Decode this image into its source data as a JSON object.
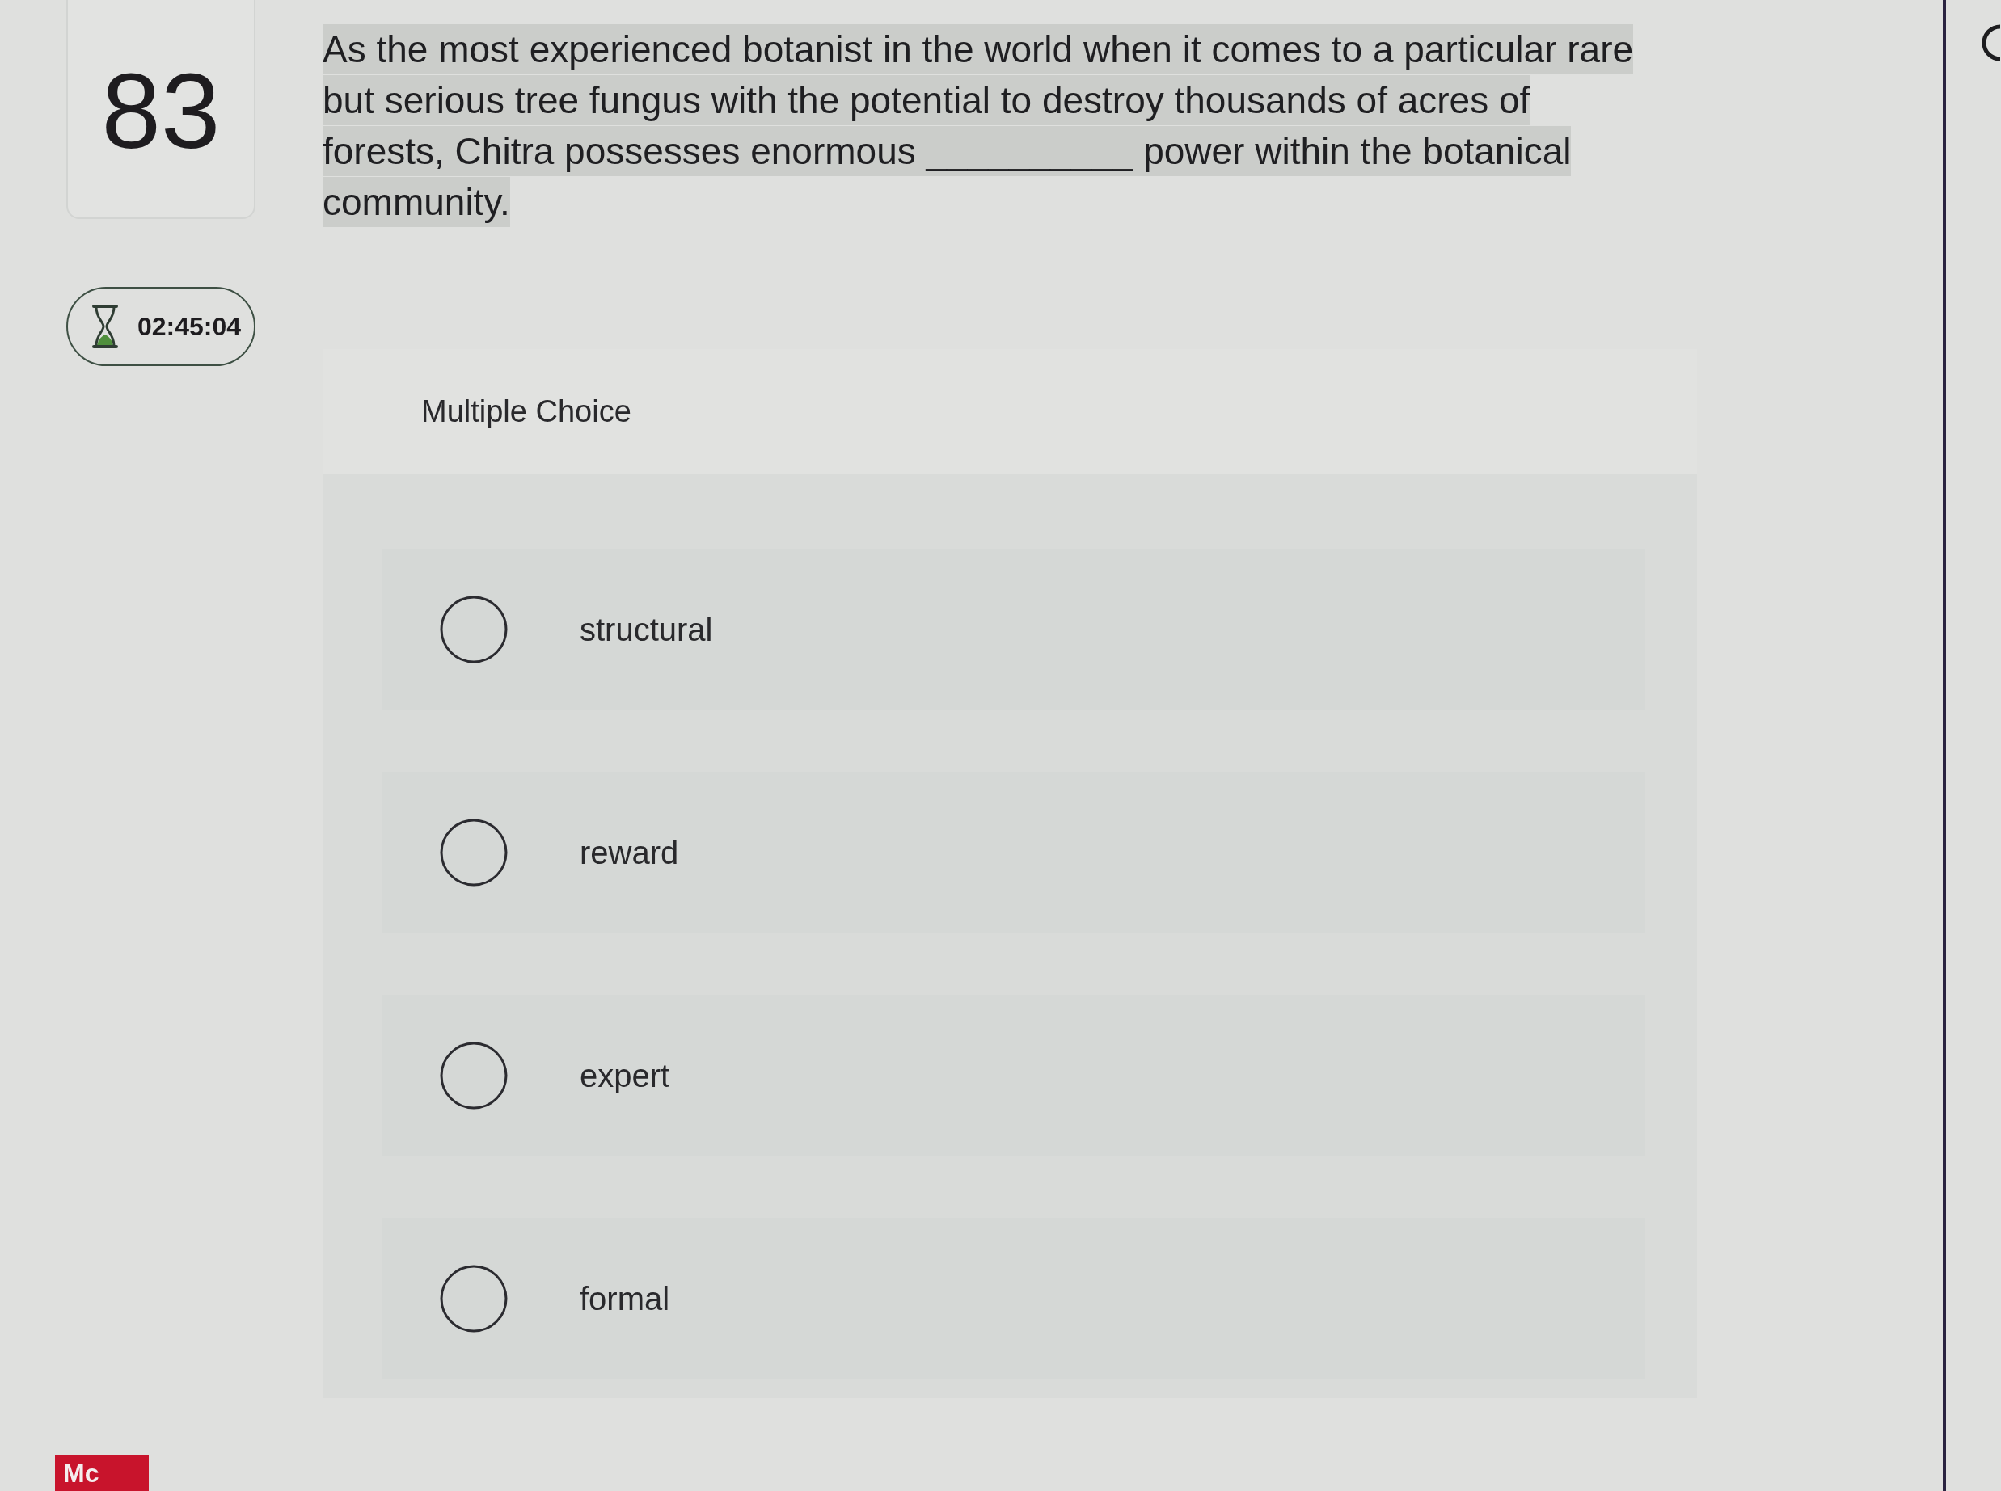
{
  "question": {
    "number": "83",
    "highlighted": true,
    "text": "As the most experienced botanist in the world when it comes to a particular rare but serious tree fungus with the potential to destroy thousands of acres of forests, Chitra possesses enormous __________ power within the botanical community."
  },
  "timer": {
    "text": "02:45:04"
  },
  "multiple_choice": {
    "title": "Multiple Choice",
    "options": [
      {
        "label": "structural",
        "selected": false
      },
      {
        "label": "reward",
        "selected": false
      },
      {
        "label": "expert",
        "selected": false
      },
      {
        "label": "formal",
        "selected": false
      }
    ]
  },
  "logo": {
    "text": "Mc"
  }
}
